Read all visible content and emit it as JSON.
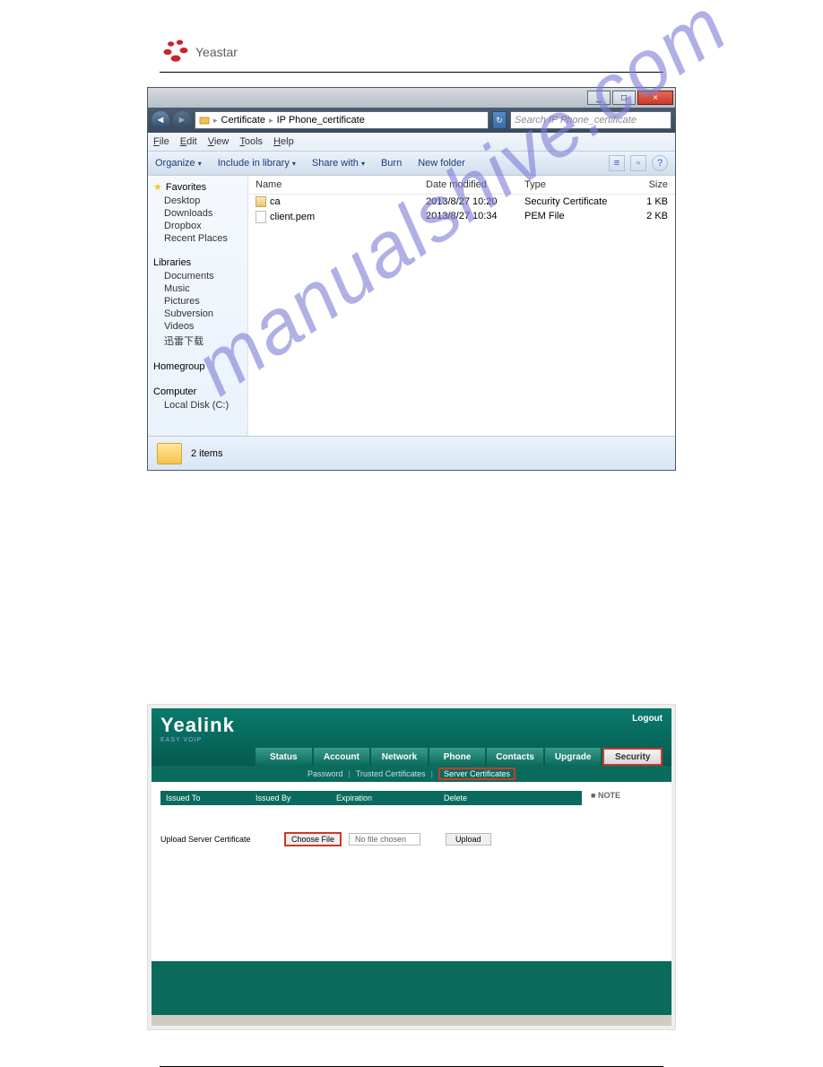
{
  "logo_text": "Yeastar",
  "watermark": "manualshive.com",
  "explorer": {
    "titlebar": {
      "min": "_",
      "max": "□",
      "close": "×"
    },
    "nav": {
      "back": "◄",
      "fwd": "►",
      "hist": "↻"
    },
    "breadcrumb": {
      "seg1": "Certificate",
      "seg2": "IP Phone_certificate",
      "sep": "▸"
    },
    "search_placeholder": "Search IP Phone_certificate",
    "menu": {
      "file": "File",
      "edit": "Edit",
      "view": "View",
      "tools": "Tools",
      "help": "Help"
    },
    "toolbar": {
      "organize": "Organize",
      "include": "Include in library",
      "share": "Share with",
      "burn": "Burn",
      "newfolder": "New folder",
      "tri": "▾",
      "view": "≡",
      "pane": "▫",
      "help": "?"
    },
    "sidebar": {
      "favorites": "Favorites",
      "fav_items": [
        "Desktop",
        "Downloads",
        "Dropbox",
        "Recent Places"
      ],
      "libraries": "Libraries",
      "lib_items": [
        "Documents",
        "Music",
        "Pictures",
        "Subversion",
        "Videos",
        "迅雷下载"
      ],
      "homegroup": "Homegroup",
      "computer": "Computer",
      "comp_items": [
        "Local Disk (C:)"
      ]
    },
    "columns": {
      "name": "Name",
      "date": "Date modified",
      "type": "Type",
      "size": "Size"
    },
    "rows": [
      {
        "name": "ca",
        "date": "2013/8/27 10:20",
        "type": "Security Certificate",
        "size": "1 KB",
        "icon": "cert"
      },
      {
        "name": "client.pem",
        "date": "2013/8/27 10:34",
        "type": "PEM File",
        "size": "2 KB",
        "icon": "file"
      }
    ],
    "status": "2 items"
  },
  "yealink": {
    "logo": "Yealink",
    "sub": "EASY VOIP",
    "logout": "Logout",
    "tabs": [
      "Status",
      "Account",
      "Network",
      "Phone",
      "Contacts",
      "Upgrade",
      "Security"
    ],
    "subtabs": {
      "password": "Password",
      "trusted": "Trusted Certificates",
      "server": "Server Certificates"
    },
    "table": {
      "issued_to": "Issued To",
      "issued_by": "Issued By",
      "expiration": "Expiration",
      "delete": "Delete"
    },
    "upload_label": "Upload Server Certificate",
    "choose_file": "Choose File",
    "no_file": "No file chosen",
    "upload": "Upload",
    "note": "NOTE",
    "bullet": "■"
  }
}
